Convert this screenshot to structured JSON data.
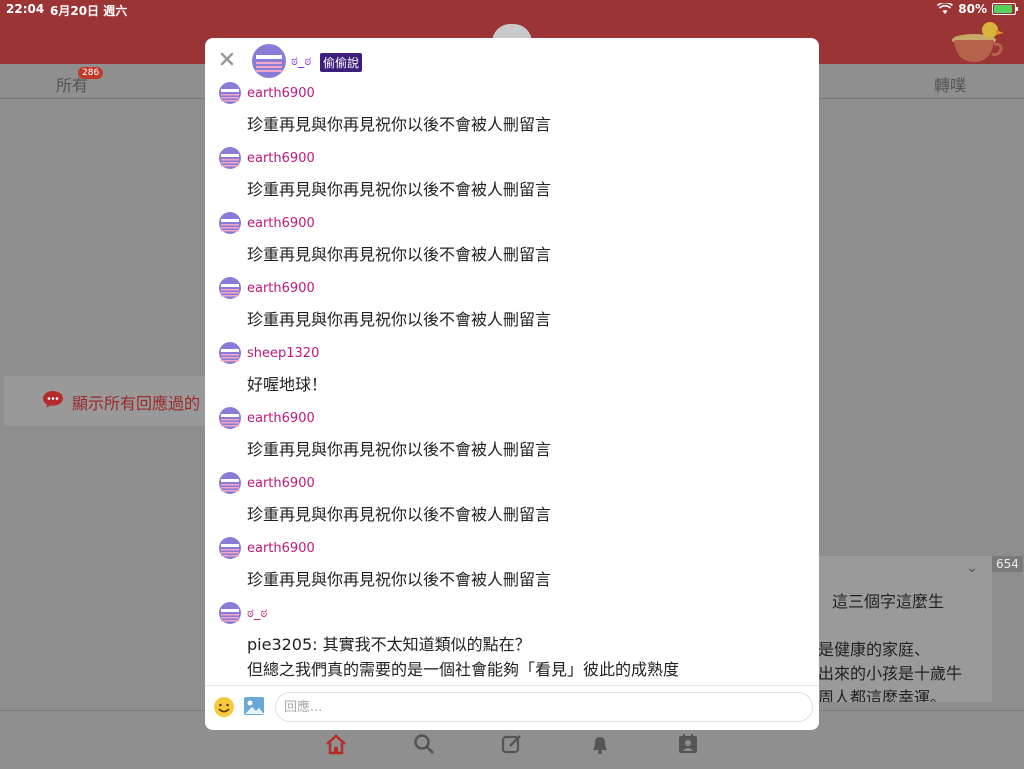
{
  "status_bar": {
    "time": "22:04",
    "date": "6月20日 週六",
    "battery": "80%",
    "battery_level": 0.8
  },
  "background": {
    "tabs": {
      "all_label": "所有",
      "all_badge": "286",
      "replurk_label": "轉噗"
    },
    "reply_filter_text": "顯示所有回應過的",
    "post_count": "654",
    "post_text_lines": [
      "這三個字這麼生",
      "是健康的家庭、",
      "出來的小孩是十歲牛",
      "周人都這麼幸運。"
    ]
  },
  "modal": {
    "owner_name": "ಠ_ಠ",
    "secret_badge": "偷偷說",
    "comments": [
      {
        "user": "earth6900",
        "lines": [
          "珍重再見與你再見祝你以後不會被人刪留言"
        ]
      },
      {
        "user": "earth6900",
        "lines": [
          "珍重再見與你再見祝你以後不會被人刪留言"
        ]
      },
      {
        "user": "earth6900",
        "lines": [
          "珍重再見與你再見祝你以後不會被人刪留言"
        ]
      },
      {
        "user": "earth6900",
        "lines": [
          "珍重再見與你再見祝你以後不會被人刪留言"
        ]
      },
      {
        "user": "sheep1320",
        "lines": [
          "好喔地球！"
        ]
      },
      {
        "user": "earth6900",
        "lines": [
          "珍重再見與你再見祝你以後不會被人刪留言"
        ]
      },
      {
        "user": "earth6900",
        "lines": [
          "珍重再見與你再見祝你以後不會被人刪留言"
        ]
      },
      {
        "user": "earth6900",
        "lines": [
          "珍重再見與你再見祝你以後不會被人刪留言"
        ]
      },
      {
        "user": "ಠ_ಠ",
        "lines": [
          "pie3205: 其實我不太知道類似的點在？",
          "但總之我們真的需要的是一個社會能夠「看見」彼此的成熟度"
        ]
      }
    ],
    "composer": {
      "placeholder": "回應..."
    }
  },
  "bottom_nav": {
    "icons": [
      "home-icon",
      "search-icon",
      "compose-icon",
      "bell-icon",
      "profile-icon"
    ]
  },
  "colors": {
    "header": "#9b3434",
    "username": "#c0187a",
    "owner": "#8a2be2",
    "badge": "#3b1f7a"
  }
}
